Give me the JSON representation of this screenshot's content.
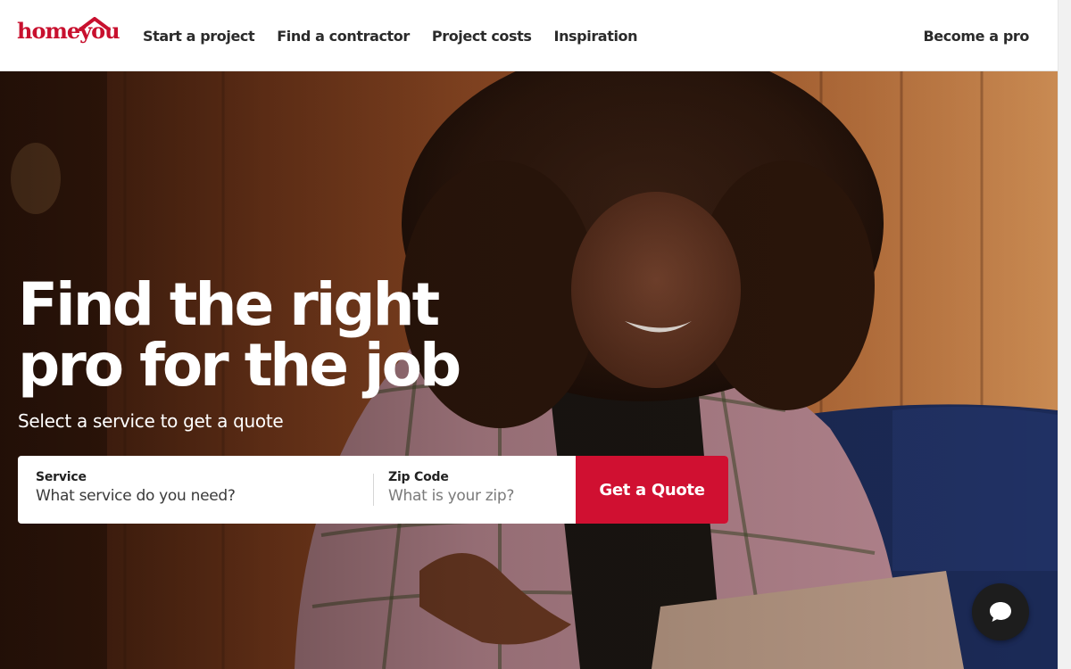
{
  "header": {
    "logo_text": "homeyou",
    "nav_items": [
      {
        "label": "Start a project"
      },
      {
        "label": "Find a contractor"
      },
      {
        "label": "Project costs"
      },
      {
        "label": "Inspiration"
      }
    ],
    "become_pro_label": "Become a pro"
  },
  "hero": {
    "title_line1": "Find the right",
    "title_line2": "pro for the job",
    "subtitle": "Select a service to get a quote",
    "service": {
      "label": "Service",
      "placeholder": "What service do you need?",
      "value": ""
    },
    "zip": {
      "label": "Zip Code",
      "placeholder": "What is your zip?",
      "value": ""
    },
    "quote_button_label": "Get a Quote"
  },
  "icons": {
    "logo_mark": "house-roof-icon",
    "chat": "chat-bubble-icon"
  },
  "colors": {
    "brand_red": "#d01031",
    "logo_red": "#c8102e",
    "text_dark": "#2b2b2b",
    "chat_bg": "#1d1d1d"
  }
}
